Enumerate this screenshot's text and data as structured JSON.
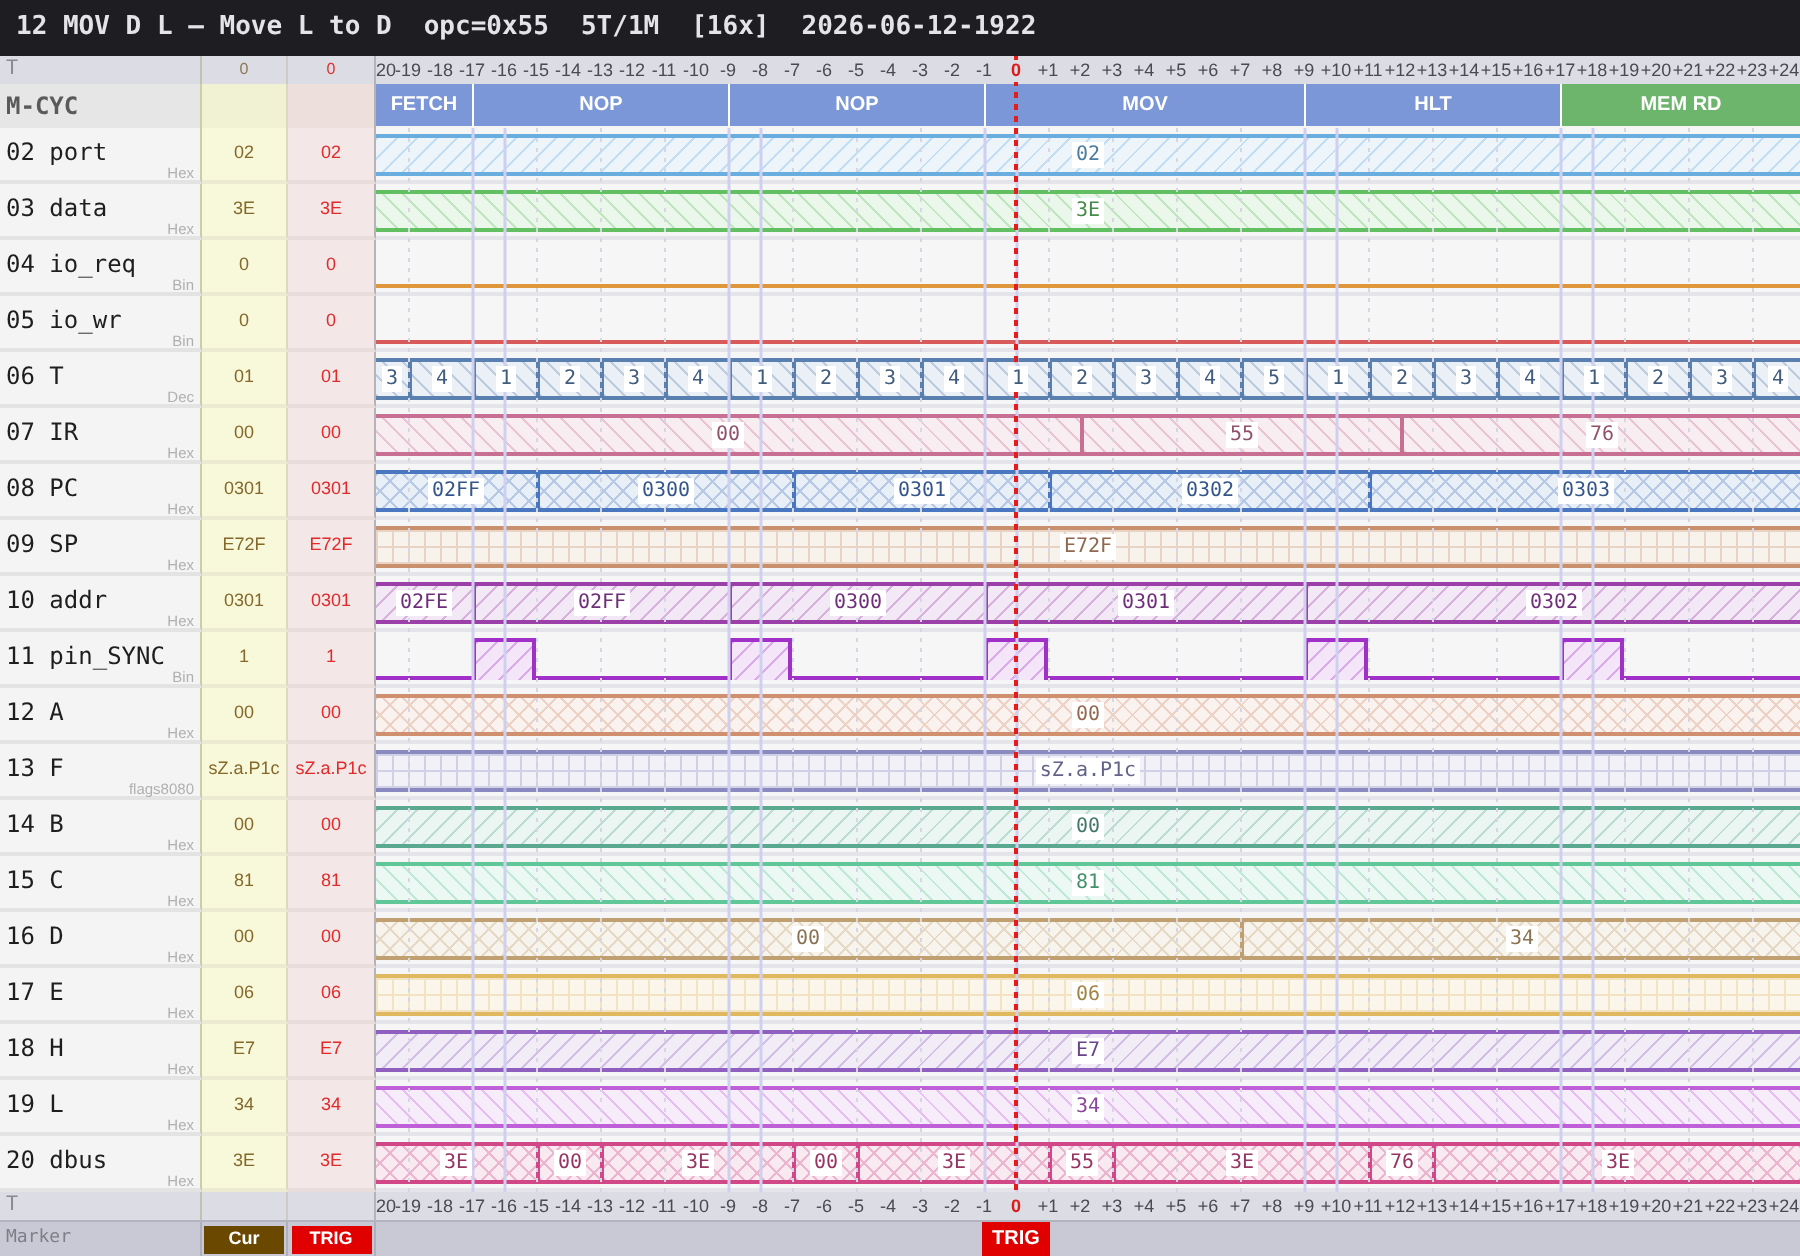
{
  "title": [
    "12 MOV D L — Move L to D",
    "opc=0x55",
    "5T/1M",
    "[16x]",
    "2026-06-12-1922"
  ],
  "header_row": {
    "label": "T",
    "cur": "0",
    "trig": "0",
    "ticks": [
      {
        "label": "20",
        "trigger": false
      },
      {
        "label": "-19",
        "trigger": false
      },
      {
        "label": "-18",
        "trigger": false
      },
      {
        "label": "-17",
        "trigger": false
      },
      {
        "label": "-16",
        "trigger": false
      },
      {
        "label": "-15",
        "trigger": false
      },
      {
        "label": "-14",
        "trigger": false
      },
      {
        "label": "-13",
        "trigger": false
      },
      {
        "label": "-12",
        "trigger": false
      },
      {
        "label": "-11",
        "trigger": false
      },
      {
        "label": "-10",
        "trigger": false
      },
      {
        "label": "-9",
        "trigger": false
      },
      {
        "label": "-8",
        "trigger": false
      },
      {
        "label": "-7",
        "trigger": false
      },
      {
        "label": "-6",
        "trigger": false
      },
      {
        "label": "-5",
        "trigger": false
      },
      {
        "label": "-4",
        "trigger": false
      },
      {
        "label": "-3",
        "trigger": false
      },
      {
        "label": "-2",
        "trigger": false
      },
      {
        "label": "-1",
        "trigger": false
      },
      {
        "label": "0",
        "trigger": true
      },
      {
        "label": "+1",
        "trigger": false
      },
      {
        "label": "+2",
        "trigger": false
      },
      {
        "label": "+3",
        "trigger": false
      },
      {
        "label": "+4",
        "trigger": false
      },
      {
        "label": "+5",
        "trigger": false
      },
      {
        "label": "+6",
        "trigger": false
      },
      {
        "label": "+7",
        "trigger": false
      },
      {
        "label": "+8",
        "trigger": false
      },
      {
        "label": "+9",
        "trigger": false
      },
      {
        "label": "+10",
        "trigger": false
      },
      {
        "label": "+11",
        "trigger": false
      },
      {
        "label": "+12",
        "trigger": false
      },
      {
        "label": "+13",
        "trigger": false
      },
      {
        "label": "+14",
        "trigger": false
      },
      {
        "label": "+15",
        "trigger": false
      },
      {
        "label": "+16",
        "trigger": false
      },
      {
        "label": "+17",
        "trigger": false
      },
      {
        "label": "+18",
        "trigger": false
      },
      {
        "label": "+19",
        "trigger": false
      },
      {
        "label": "+20",
        "trigger": false
      },
      {
        "label": "+21",
        "trigger": false
      },
      {
        "label": "+22",
        "trigger": false
      },
      {
        "label": "+23",
        "trigger": false
      },
      {
        "label": "+24",
        "trigger": false
      }
    ]
  },
  "mcycle_row": {
    "label": "M-CYC",
    "cycles": [
      {
        "label": "FETCH",
        "color": "#7b97d8"
      },
      {
        "label": "NOP",
        "color": "#7b97d8"
      },
      {
        "label": "NOP",
        "color": "#7b97d8"
      },
      {
        "label": "MOV",
        "color": "#7b97d8"
      },
      {
        "label": "HLT",
        "color": "#7b97d8"
      },
      {
        "label": "MEM RD",
        "color": "#6db56d"
      }
    ]
  },
  "signals": [
    {
      "name": "02 port",
      "format": "Hex",
      "cur": "02",
      "trig": "02",
      "kind": "bus",
      "color": "#6aaee0",
      "segments": [
        {
          "value": "02"
        }
      ]
    },
    {
      "name": "03 data",
      "format": "Hex",
      "cur": "3E",
      "trig": "3E",
      "kind": "bus",
      "color": "#62bf62",
      "segments": [
        {
          "value": "3E"
        }
      ]
    },
    {
      "name": "04 io_req",
      "format": "Bin",
      "cur": "0",
      "trig": "0",
      "kind": "bit",
      "color": "#e0963a",
      "segments": [
        {
          "high": false
        }
      ]
    },
    {
      "name": "05 io_wr",
      "format": "Bin",
      "cur": "0",
      "trig": "0",
      "kind": "bit",
      "color": "#d85a5a",
      "segments": [
        {
          "high": false
        }
      ]
    },
    {
      "name": "06 T",
      "format": "Dec",
      "cur": "01",
      "trig": "01",
      "kind": "bus",
      "color": "#5a80b0",
      "segments": [
        {
          "value": "3"
        },
        {
          "value": "4"
        },
        {
          "value": "1"
        },
        {
          "value": "2"
        },
        {
          "value": "3"
        },
        {
          "value": "4"
        },
        {
          "value": "1"
        },
        {
          "value": "2"
        },
        {
          "value": "3"
        },
        {
          "value": "4"
        },
        {
          "value": "1"
        },
        {
          "value": "2"
        },
        {
          "value": "3"
        },
        {
          "value": "4"
        },
        {
          "value": "5"
        },
        {
          "value": "1"
        },
        {
          "value": "2"
        },
        {
          "value": "3"
        },
        {
          "value": "4"
        },
        {
          "value": "1"
        },
        {
          "value": "2"
        },
        {
          "value": "3"
        },
        {
          "value": "4"
        }
      ]
    },
    {
      "name": "07 IR",
      "format": "Hex",
      "cur": "00",
      "trig": "00",
      "kind": "bus",
      "color": "#c87094",
      "segments": [
        {
          "value": "00"
        },
        {
          "value": "55"
        },
        {
          "value": "76"
        }
      ]
    },
    {
      "name": "08 PC",
      "format": "Hex",
      "cur": "0301",
      "trig": "0301",
      "kind": "bus",
      "color": "#4a78c0",
      "segments": [
        {
          "value": "02FF"
        },
        {
          "value": "0300"
        },
        {
          "value": "0301"
        },
        {
          "value": "0302"
        },
        {
          "value": "0303"
        }
      ]
    },
    {
      "name": "09 SP",
      "format": "Hex",
      "cur": "E72F",
      "trig": "E72F",
      "kind": "bus",
      "color": "#c8906c",
      "segments": [
        {
          "value": "E72F"
        }
      ]
    },
    {
      "name": "10 addr",
      "format": "Hex",
      "cur": "0301",
      "trig": "0301",
      "kind": "bus",
      "color": "#9a40a8",
      "segments": [
        {
          "value": "02FE"
        },
        {
          "value": "02FF"
        },
        {
          "value": "0300"
        },
        {
          "value": "0301"
        },
        {
          "value": "0302"
        }
      ]
    },
    {
      "name": "11 pin_SYNC",
      "format": "Bin",
      "cur": "1",
      "trig": "1",
      "kind": "bit",
      "color": "#a030c8",
      "segments": [
        {
          "high": false
        },
        {
          "high": true
        },
        {
          "high": false
        },
        {
          "high": true
        },
        {
          "high": false
        },
        {
          "high": true
        },
        {
          "high": false
        },
        {
          "high": true
        },
        {
          "high": false
        },
        {
          "high": true
        },
        {
          "high": false
        }
      ]
    },
    {
      "name": "12 A",
      "format": "Hex",
      "cur": "00",
      "trig": "00",
      "kind": "bus",
      "color": "#d09070",
      "segments": [
        {
          "value": "00"
        }
      ]
    },
    {
      "name": "13 F",
      "format": "flags8080",
      "cur": "sZ.a.P1c",
      "trig": "sZ.a.P1c",
      "kind": "bus",
      "color": "#8a8ac0",
      "segments": [
        {
          "value": "sZ.a.P1c"
        }
      ]
    },
    {
      "name": "14 B",
      "format": "Hex",
      "cur": "00",
      "trig": "00",
      "kind": "bus",
      "color": "#5aa890",
      "segments": [
        {
          "value": "00"
        }
      ]
    },
    {
      "name": "15 C",
      "format": "Hex",
      "cur": "81",
      "trig": "81",
      "kind": "bus",
      "color": "#60c898",
      "segments": [
        {
          "value": "81"
        }
      ]
    },
    {
      "name": "16 D",
      "format": "Hex",
      "cur": "00",
      "trig": "00",
      "kind": "bus",
      "color": "#c0a070",
      "segments": [
        {
          "value": "00"
        },
        {
          "value": "34"
        }
      ]
    },
    {
      "name": "17 E",
      "format": "Hex",
      "cur": "06",
      "trig": "06",
      "kind": "bus",
      "color": "#e0b860",
      "segments": [
        {
          "value": "06"
        }
      ]
    },
    {
      "name": "18 H",
      "format": "Hex",
      "cur": "E7",
      "trig": "E7",
      "kind": "bus",
      "color": "#9060c0",
      "segments": [
        {
          "value": "E7"
        }
      ]
    },
    {
      "name": "19 L",
      "format": "Hex",
      "cur": "34",
      "trig": "34",
      "kind": "bus",
      "color": "#c060d8",
      "segments": [
        {
          "value": "34"
        }
      ]
    },
    {
      "name": "20 dbus",
      "format": "Hex",
      "cur": "3E",
      "trig": "3E",
      "kind": "bus",
      "color": "#d04888",
      "segments": [
        {
          "value": "3E"
        },
        {
          "value": "00"
        },
        {
          "value": "3E"
        },
        {
          "value": "00"
        },
        {
          "value": "3E"
        },
        {
          "value": "55"
        },
        {
          "value": "3E"
        },
        {
          "value": "76"
        },
        {
          "value": "3E"
        }
      ]
    }
  ],
  "footer_row": {
    "label": "T",
    "ticks": [
      {
        "label": "20",
        "trigger": false
      },
      {
        "label": "-19",
        "trigger": false
      },
      {
        "label": "-18",
        "trigger": false
      },
      {
        "label": "-17",
        "trigger": false
      },
      {
        "label": "-16",
        "trigger": false
      },
      {
        "label": "-15",
        "trigger": false
      },
      {
        "label": "-14",
        "trigger": false
      },
      {
        "label": "-13",
        "trigger": false
      },
      {
        "label": "-12",
        "trigger": false
      },
      {
        "label": "-11",
        "trigger": false
      },
      {
        "label": "-10",
        "trigger": false
      },
      {
        "label": "-9",
        "trigger": false
      },
      {
        "label": "-8",
        "trigger": false
      },
      {
        "label": "-7",
        "trigger": false
      },
      {
        "label": "-6",
        "trigger": false
      },
      {
        "label": "-5",
        "trigger": false
      },
      {
        "label": "-4",
        "trigger": false
      },
      {
        "label": "-3",
        "trigger": false
      },
      {
        "label": "-2",
        "trigger": false
      },
      {
        "label": "-1",
        "trigger": false
      },
      {
        "label": "0",
        "trigger": true
      },
      {
        "label": "+1",
        "trigger": false
      },
      {
        "label": "+2",
        "trigger": false
      },
      {
        "label": "+3",
        "trigger": false
      },
      {
        "label": "+4",
        "trigger": false
      },
      {
        "label": "+5",
        "trigger": false
      },
      {
        "label": "+6",
        "trigger": false
      },
      {
        "label": "+7",
        "trigger": false
      },
      {
        "label": "+8",
        "trigger": false
      },
      {
        "label": "+9",
        "trigger": false
      },
      {
        "label": "+10",
        "trigger": false
      },
      {
        "label": "+11",
        "trigger": false
      },
      {
        "label": "+12",
        "trigger": false
      },
      {
        "label": "+13",
        "trigger": false
      },
      {
        "label": "+14",
        "trigger": false
      },
      {
        "label": "+15",
        "trigger": false
      },
      {
        "label": "+16",
        "trigger": false
      },
      {
        "label": "+17",
        "trigger": false
      },
      {
        "label": "+18",
        "trigger": false
      },
      {
        "label": "+19",
        "trigger": false
      },
      {
        "label": "+20",
        "trigger": false
      },
      {
        "label": "+21",
        "trigger": false
      },
      {
        "label": "+22",
        "trigger": false
      },
      {
        "label": "+23",
        "trigger": false
      },
      {
        "label": "+24",
        "trigger": false
      }
    ]
  },
  "marker_row": {
    "label": "Marker",
    "cursor_button": "Cur",
    "trigger_button": "TRIG",
    "trigger_flag": "TRIG"
  }
}
